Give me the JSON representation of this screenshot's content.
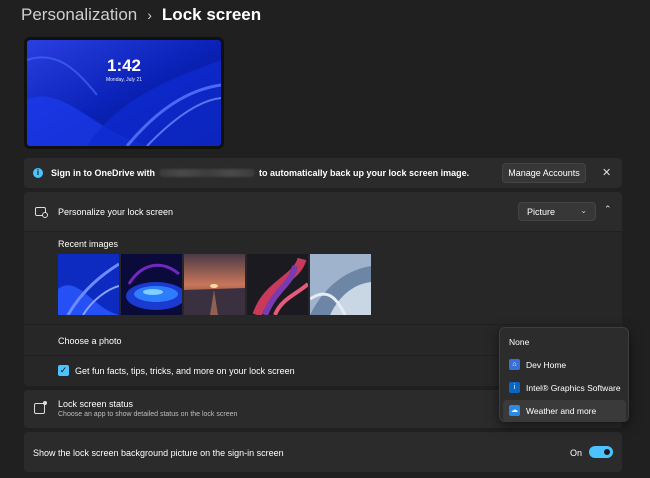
{
  "breadcrumb": {
    "parent": "Personalization",
    "separator": "›",
    "current": "Lock screen"
  },
  "preview": {
    "time": "1:42",
    "date": "Monday, July 21"
  },
  "info_bar": {
    "icon": "info-icon",
    "text_before": "Sign in to OneDrive with",
    "text_after": "to automatically back up your lock screen image.",
    "manage_button": "Manage Accounts",
    "close": "✕"
  },
  "personalize": {
    "label": "Personalize your lock screen",
    "dropdown_value": "Picture",
    "dropdown_chevron": "⌄",
    "collapse_chevron": "⌃"
  },
  "recent": {
    "label": "Recent images"
  },
  "choose": {
    "label": "Choose a photo"
  },
  "facts": {
    "label": "Get fun facts, tips, tricks, and more on your lock screen",
    "checked": true,
    "check_glyph": "✓"
  },
  "status": {
    "label": "Lock screen status",
    "sublabel": "Choose an app to show detailed status on the lock screen"
  },
  "signin_bg": {
    "label": "Show the lock screen background picture on the sign-in screen",
    "toggle_label": "On",
    "toggle_on": true
  },
  "menu": {
    "items": [
      {
        "label": "None",
        "icon": ""
      },
      {
        "label": "Dev Home",
        "icon": "dev-home-icon"
      },
      {
        "label": "Intel® Graphics Software",
        "icon": "intel-graphics-icon"
      },
      {
        "label": "Weather and more",
        "icon": "weather-icon",
        "selected": true
      }
    ]
  },
  "colors": {
    "accent": "#4cc2ff",
    "background": "#202020",
    "card": "#2b2b2b"
  }
}
